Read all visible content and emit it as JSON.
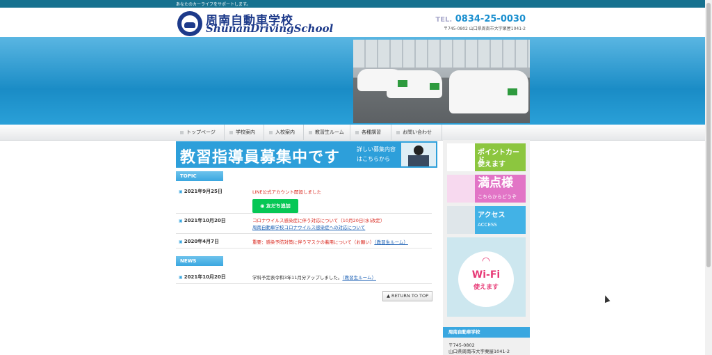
{
  "topbar": {
    "tagline": "あなたのカーライフをサポートします。"
  },
  "header": {
    "brand_jp": "周南自動車学校",
    "brand_en": "ShunanDrivingSchool",
    "tel_label": "TEL.",
    "tel_number": "0834-25-0030",
    "address": "〒745-0802 山口県周南市大字栗屋1041-2"
  },
  "nav": {
    "items": [
      "トップページ",
      "学校案内",
      "入校案内",
      "教習生ルーム",
      "各種講習",
      "お問い合わせ"
    ]
  },
  "banner": {
    "title": "教習指導員募集中です",
    "line1": "詳しい募集内容",
    "line2": "はこちらから"
  },
  "topic": {
    "heading": "TOPIC",
    "items": [
      {
        "date": "2021年9月25日",
        "text": "LINE公式アカウント開設しました",
        "button": "友だち追加"
      },
      {
        "date": "2021年10月20日",
        "text": "コロナウイルス感染症に伴う対応について（10月20日(水)改定）",
        "link": "周南自動車学校コロナウイルス感染症への対応について"
      },
      {
        "date": "2020年4月7日",
        "text": "重要：感染予防対策に伴うマスクの着用について（お願い）",
        "link": "（教習生ルーム）"
      }
    ]
  },
  "news": {
    "heading": "NEWS",
    "items": [
      {
        "date": "2021年10月20日",
        "text": "学科予定表令和3年11月分アップしました。",
        "link": "（教習生ルーム）"
      }
    ]
  },
  "return_top": "RETURN TO TOP",
  "sidebar": {
    "ad1": {
      "title": "ポイントカード",
      "sub": "使えます"
    },
    "ad2": {
      "title": "満点様",
      "sub": "こちらからどうぞ"
    },
    "ad3": {
      "title": "アクセス",
      "sub": "ACCESS"
    },
    "ad4": {
      "title": "Wi-Fi",
      "sub": "使えます"
    },
    "info_head": "周南自動車学校",
    "info_zip": "〒745-0802",
    "info_addr": "山口県周南市大字栗屋1041-2"
  },
  "colors": {
    "accent": "#3aa7e0",
    "brand": "#1d3a8a",
    "alert": "#d9261c",
    "line": "#06c755"
  }
}
